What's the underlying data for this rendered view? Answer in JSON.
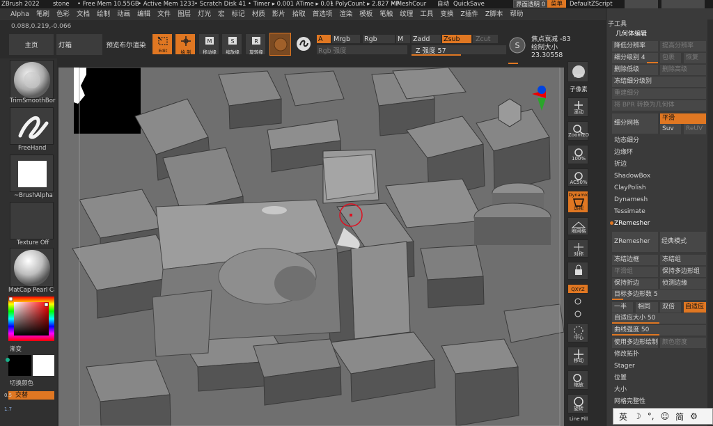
{
  "titlebar": {
    "app": "ZBrush 2022",
    "doc": "stone",
    "free_mem": "• Free Mem 10.55GB",
    "active_mem": "• Active Mem 1233",
    "scratch": "• Scratch Disk 41",
    "timer": "• Timer ▸ 0.001 ATime ▸ 0.01",
    "poly": "• PolyCount ▸ 2.827 MP",
    "mesh": "• MeshCour",
    "auto": "自动",
    "quicksave": "QuickSave",
    "transparency": "界面透明 0",
    "menu_btn": "菜单",
    "script": "DefaultZScript"
  },
  "menubar": [
    "Alpha",
    "笔刷",
    "色彩",
    "文档",
    "绘制",
    "动画",
    "编辑",
    "文件",
    "图层",
    "灯光",
    "宏",
    "标记",
    "材质",
    "影片",
    "拾取",
    "首选项",
    "渲染",
    "模板",
    "笔触",
    "纹理",
    "工具",
    "变换",
    "Z插件",
    "Z脚本",
    "帮助"
  ],
  "coords": "0.088,0.219,-0.066",
  "toolbar": {
    "home": "主页",
    "lightbox": "灯箱",
    "bpr": "预览布尔渲染",
    "edit": "Edit",
    "draw": "绘 制",
    "move": "移动缘",
    "scale": "缩放缘",
    "rotate": "旋转缘",
    "a": "A",
    "mrgb": "Mrgb",
    "rgb": "Rgb",
    "m": "M",
    "zadd": "Zadd",
    "zsub": "Zsub",
    "zcut": "Zcut",
    "rgb_intensity": "Rgb 强度",
    "z_intensity": "Z 强度 57",
    "focal": "焦点衰减 -83",
    "draw_size": "绘制大小 23.30558"
  },
  "leftpanel": {
    "brush": "TrimSmoothBor",
    "stroke": "FreeHand",
    "alpha": "~BrushAlpha",
    "texture": "Texture Off",
    "material": "MatCap Pearl Ca",
    "gradient": "渐变",
    "swap": "切换颜色",
    "alternate": "交替",
    "val1": "0.5",
    "val2": "1.7"
  },
  "shelf": {
    "bpr": "BPR",
    "subpixel": "子像素",
    "scroll": "滚动",
    "zoom2d": "Zoom2D",
    "pct100": "100%",
    "ac50": "AC50%",
    "dynamic": "Dynamic",
    "persp": "透视",
    "floor": "地网格",
    "sym": "对称",
    "xyz": "QXYZ",
    "center": "中心",
    "move": "移动",
    "zoom": "缩放",
    "rotate": "旋转",
    "linefill": "Line Fill"
  },
  "rightpanel": {
    "header": "子工具",
    "section": "几何体编辑",
    "lower_res": "降低分辨率",
    "higher_res": "提高分辨率",
    "subdiv_level": "细分级别 4",
    "cage": "包裹",
    "restore": "恢复",
    "del_lower": "删除低级",
    "del_higher": "删除高级",
    "freeze": "冻结细分级别",
    "rebuild": "重建细分",
    "bpr_geo": "将 BPR 转换为几何体",
    "divide": "细分网格",
    "smooth": "平滑",
    "suv": "Suv",
    "reuv": "ReUV",
    "dynamic_sub": "动态细分",
    "edge_loop": "边缘环",
    "crease": "折边",
    "shadowbox": "ShadowBox",
    "claypolish": "ClayPolish",
    "dynamesh": "Dynamesh",
    "tessimate": "Tessimate",
    "zremesher_title": "ZRemesher",
    "zremesher_btn": "ZRemesher",
    "legacy": "经典模式(2018)",
    "freeze_border": "冻结边框",
    "freeze_groups": "冻结组",
    "smooth_groups": "平滑组",
    "keep_polys": "保持多边形组",
    "keep_crease": "保持折边",
    "detect_edges": "侦测边缘",
    "target_polys": "目标多边形数 5",
    "half": "一半",
    "same": "相同",
    "double": "双倍",
    "adaptive": "自适应",
    "adaptive_size": "自适应大小 50",
    "curve_strength": "曲线强度 50",
    "use_polypaint": "使用多边形绘制",
    "color_density": "颜色密度",
    "mod_topo": "修改拓扑",
    "stager": "Stager",
    "position": "位置",
    "size": "大小",
    "mesh_integrity": "网格完整性"
  },
  "ime": [
    "英",
    "☽",
    "°,",
    "☺",
    "简",
    "⚙"
  ]
}
